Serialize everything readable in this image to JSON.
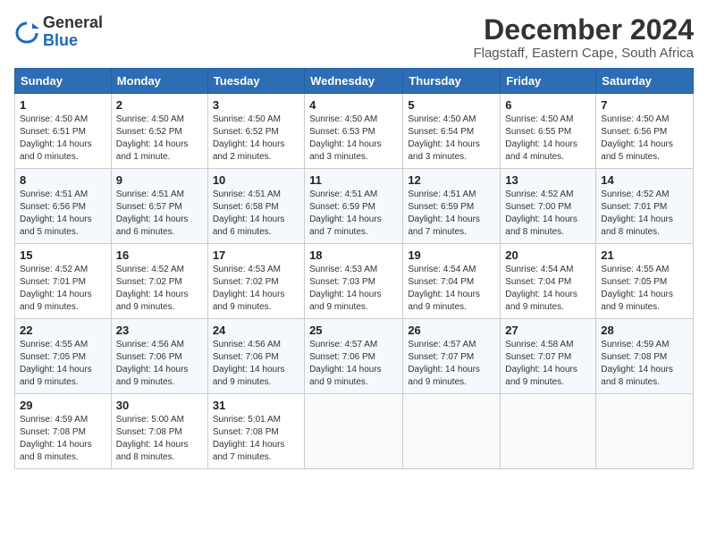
{
  "logo": {
    "general": "General",
    "blue": "Blue"
  },
  "title": "December 2024",
  "subtitle": "Flagstaff, Eastern Cape, South Africa",
  "header": {
    "days": [
      "Sunday",
      "Monday",
      "Tuesday",
      "Wednesday",
      "Thursday",
      "Friday",
      "Saturday"
    ]
  },
  "weeks": [
    [
      {
        "day": "1",
        "sunrise": "Sunrise: 4:50 AM",
        "sunset": "Sunset: 6:51 PM",
        "daylight": "Daylight: 14 hours and 0 minutes."
      },
      {
        "day": "2",
        "sunrise": "Sunrise: 4:50 AM",
        "sunset": "Sunset: 6:52 PM",
        "daylight": "Daylight: 14 hours and 1 minute."
      },
      {
        "day": "3",
        "sunrise": "Sunrise: 4:50 AM",
        "sunset": "Sunset: 6:52 PM",
        "daylight": "Daylight: 14 hours and 2 minutes."
      },
      {
        "day": "4",
        "sunrise": "Sunrise: 4:50 AM",
        "sunset": "Sunset: 6:53 PM",
        "daylight": "Daylight: 14 hours and 3 minutes."
      },
      {
        "day": "5",
        "sunrise": "Sunrise: 4:50 AM",
        "sunset": "Sunset: 6:54 PM",
        "daylight": "Daylight: 14 hours and 3 minutes."
      },
      {
        "day": "6",
        "sunrise": "Sunrise: 4:50 AM",
        "sunset": "Sunset: 6:55 PM",
        "daylight": "Daylight: 14 hours and 4 minutes."
      },
      {
        "day": "7",
        "sunrise": "Sunrise: 4:50 AM",
        "sunset": "Sunset: 6:56 PM",
        "daylight": "Daylight: 14 hours and 5 minutes."
      }
    ],
    [
      {
        "day": "8",
        "sunrise": "Sunrise: 4:51 AM",
        "sunset": "Sunset: 6:56 PM",
        "daylight": "Daylight: 14 hours and 5 minutes."
      },
      {
        "day": "9",
        "sunrise": "Sunrise: 4:51 AM",
        "sunset": "Sunset: 6:57 PM",
        "daylight": "Daylight: 14 hours and 6 minutes."
      },
      {
        "day": "10",
        "sunrise": "Sunrise: 4:51 AM",
        "sunset": "Sunset: 6:58 PM",
        "daylight": "Daylight: 14 hours and 6 minutes."
      },
      {
        "day": "11",
        "sunrise": "Sunrise: 4:51 AM",
        "sunset": "Sunset: 6:59 PM",
        "daylight": "Daylight: 14 hours and 7 minutes."
      },
      {
        "day": "12",
        "sunrise": "Sunrise: 4:51 AM",
        "sunset": "Sunset: 6:59 PM",
        "daylight": "Daylight: 14 hours and 7 minutes."
      },
      {
        "day": "13",
        "sunrise": "Sunrise: 4:52 AM",
        "sunset": "Sunset: 7:00 PM",
        "daylight": "Daylight: 14 hours and 8 minutes."
      },
      {
        "day": "14",
        "sunrise": "Sunrise: 4:52 AM",
        "sunset": "Sunset: 7:01 PM",
        "daylight": "Daylight: 14 hours and 8 minutes."
      }
    ],
    [
      {
        "day": "15",
        "sunrise": "Sunrise: 4:52 AM",
        "sunset": "Sunset: 7:01 PM",
        "daylight": "Daylight: 14 hours and 9 minutes."
      },
      {
        "day": "16",
        "sunrise": "Sunrise: 4:52 AM",
        "sunset": "Sunset: 7:02 PM",
        "daylight": "Daylight: 14 hours and 9 minutes."
      },
      {
        "day": "17",
        "sunrise": "Sunrise: 4:53 AM",
        "sunset": "Sunset: 7:02 PM",
        "daylight": "Daylight: 14 hours and 9 minutes."
      },
      {
        "day": "18",
        "sunrise": "Sunrise: 4:53 AM",
        "sunset": "Sunset: 7:03 PM",
        "daylight": "Daylight: 14 hours and 9 minutes."
      },
      {
        "day": "19",
        "sunrise": "Sunrise: 4:54 AM",
        "sunset": "Sunset: 7:04 PM",
        "daylight": "Daylight: 14 hours and 9 minutes."
      },
      {
        "day": "20",
        "sunrise": "Sunrise: 4:54 AM",
        "sunset": "Sunset: 7:04 PM",
        "daylight": "Daylight: 14 hours and 9 minutes."
      },
      {
        "day": "21",
        "sunrise": "Sunrise: 4:55 AM",
        "sunset": "Sunset: 7:05 PM",
        "daylight": "Daylight: 14 hours and 9 minutes."
      }
    ],
    [
      {
        "day": "22",
        "sunrise": "Sunrise: 4:55 AM",
        "sunset": "Sunset: 7:05 PM",
        "daylight": "Daylight: 14 hours and 9 minutes."
      },
      {
        "day": "23",
        "sunrise": "Sunrise: 4:56 AM",
        "sunset": "Sunset: 7:06 PM",
        "daylight": "Daylight: 14 hours and 9 minutes."
      },
      {
        "day": "24",
        "sunrise": "Sunrise: 4:56 AM",
        "sunset": "Sunset: 7:06 PM",
        "daylight": "Daylight: 14 hours and 9 minutes."
      },
      {
        "day": "25",
        "sunrise": "Sunrise: 4:57 AM",
        "sunset": "Sunset: 7:06 PM",
        "daylight": "Daylight: 14 hours and 9 minutes."
      },
      {
        "day": "26",
        "sunrise": "Sunrise: 4:57 AM",
        "sunset": "Sunset: 7:07 PM",
        "daylight": "Daylight: 14 hours and 9 minutes."
      },
      {
        "day": "27",
        "sunrise": "Sunrise: 4:58 AM",
        "sunset": "Sunset: 7:07 PM",
        "daylight": "Daylight: 14 hours and 9 minutes."
      },
      {
        "day": "28",
        "sunrise": "Sunrise: 4:59 AM",
        "sunset": "Sunset: 7:08 PM",
        "daylight": "Daylight: 14 hours and 8 minutes."
      }
    ],
    [
      {
        "day": "29",
        "sunrise": "Sunrise: 4:59 AM",
        "sunset": "Sunset: 7:08 PM",
        "daylight": "Daylight: 14 hours and 8 minutes."
      },
      {
        "day": "30",
        "sunrise": "Sunrise: 5:00 AM",
        "sunset": "Sunset: 7:08 PM",
        "daylight": "Daylight: 14 hours and 8 minutes."
      },
      {
        "day": "31",
        "sunrise": "Sunrise: 5:01 AM",
        "sunset": "Sunset: 7:08 PM",
        "daylight": "Daylight: 14 hours and 7 minutes."
      },
      null,
      null,
      null,
      null
    ]
  ]
}
